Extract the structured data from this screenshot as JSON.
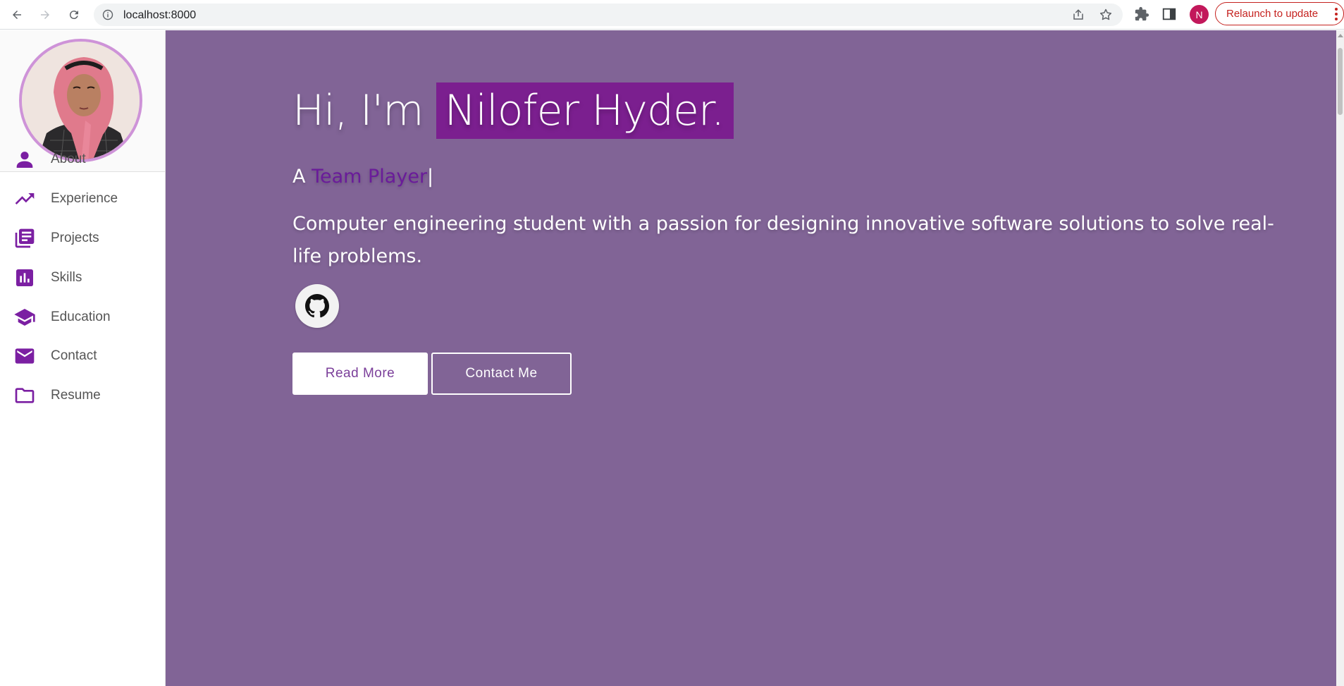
{
  "browser": {
    "url": "localhost:8000",
    "profile_initial": "N",
    "relaunch_label": "Relaunch to update",
    "accent": "#c5221f"
  },
  "sidebar": {
    "items": [
      {
        "label": "About",
        "icon": "person-icon"
      },
      {
        "label": "Experience",
        "icon": "trending-up-icon"
      },
      {
        "label": "Projects",
        "icon": "library-books-icon"
      },
      {
        "label": "Skills",
        "icon": "bar-chart-icon"
      },
      {
        "label": "Education",
        "icon": "graduation-cap-icon"
      },
      {
        "label": "Contact",
        "icon": "mail-icon"
      },
      {
        "label": "Resume",
        "icon": "folder-icon"
      }
    ],
    "icon_color": "#7b1fa2"
  },
  "hero": {
    "greeting": "Hi, I'm",
    "name": "Nilofer Hyder.",
    "tagline_prefix": "A",
    "tagline_role": "Team Player",
    "tagline_cursor": "|",
    "description": "Computer engineering student with a passion for designing innovative software solutions to solve real-life problems.",
    "read_more_label": "Read More",
    "contact_label": "Contact Me",
    "background": "#816496",
    "highlight": "#7b1f8f"
  }
}
